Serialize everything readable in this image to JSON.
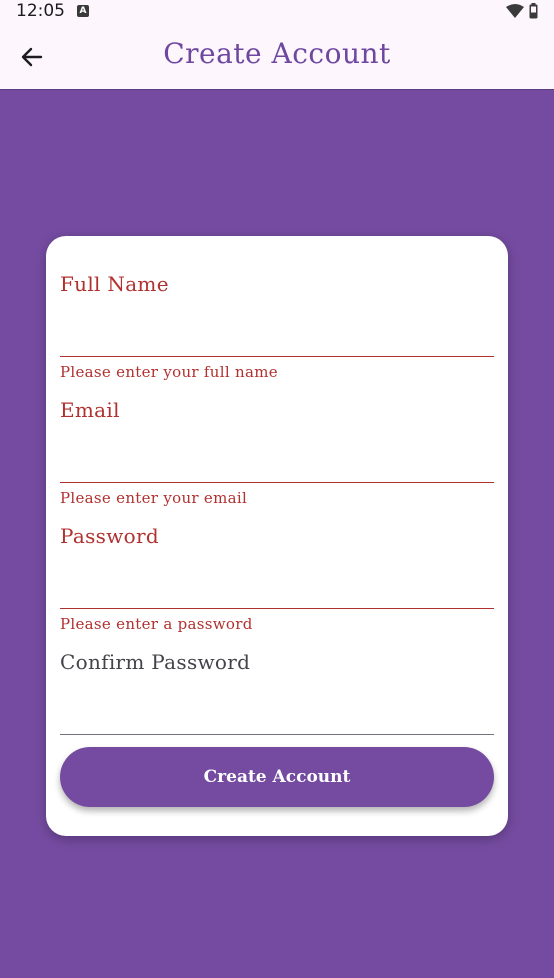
{
  "status_bar": {
    "time": "12:05",
    "notification_icon": "a-icon",
    "wifi_icon": "wifi-icon",
    "battery_icon": "battery-icon"
  },
  "app_bar": {
    "title": "Create Account",
    "back_icon": "arrow-back-icon"
  },
  "form": {
    "fields": [
      {
        "label": "Full Name",
        "error": "Please enter your full name",
        "state": "error"
      },
      {
        "label": "Email",
        "error": "Please enter your email",
        "state": "error"
      },
      {
        "label": "Password",
        "error": "Please enter a password",
        "state": "error"
      },
      {
        "label": "Confirm Password",
        "error": "",
        "state": "normal"
      }
    ],
    "submit_label": "Create Account"
  },
  "colors": {
    "primary": "#744ba0",
    "title": "#6d47a0",
    "error": "#b0312f",
    "app_bar_bg": "#fef6fd",
    "card_bg": "#ffffff"
  }
}
